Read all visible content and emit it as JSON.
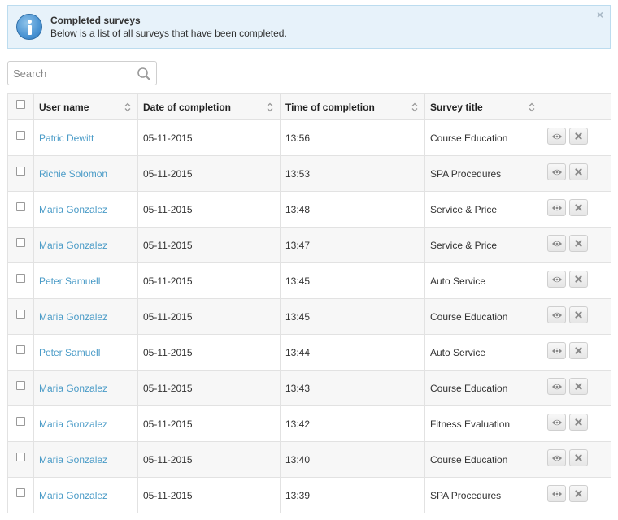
{
  "alert": {
    "title": "Completed surveys",
    "text": "Below is a list of all surveys that have been completed.",
    "close_glyph": "×",
    "icon": "info-icon",
    "accent_color": "#4b94d3"
  },
  "search": {
    "placeholder": "Search",
    "value": ""
  },
  "table": {
    "columns": {
      "user": "User name",
      "date": "Date of completion",
      "time": "Time of completion",
      "survey": "Survey title"
    },
    "link_color": "#4a9bc7",
    "rows": [
      {
        "user": "Patric Dewitt",
        "date": "05-11-2015",
        "time": "13:56",
        "survey": "Course Education"
      },
      {
        "user": "Richie Solomon",
        "date": "05-11-2015",
        "time": "13:53",
        "survey": "SPA Procedures"
      },
      {
        "user": "Maria Gonzalez",
        "date": "05-11-2015",
        "time": "13:48",
        "survey": "Service & Price"
      },
      {
        "user": "Maria Gonzalez",
        "date": "05-11-2015",
        "time": "13:47",
        "survey": "Service & Price"
      },
      {
        "user": "Peter Samuell",
        "date": "05-11-2015",
        "time": "13:45",
        "survey": "Auto Service"
      },
      {
        "user": "Maria Gonzalez",
        "date": "05-11-2015",
        "time": "13:45",
        "survey": "Course Education"
      },
      {
        "user": "Peter Samuell",
        "date": "05-11-2015",
        "time": "13:44",
        "survey": "Auto Service"
      },
      {
        "user": "Maria Gonzalez",
        "date": "05-11-2015",
        "time": "13:43",
        "survey": "Course Education"
      },
      {
        "user": "Maria Gonzalez",
        "date": "05-11-2015",
        "time": "13:42",
        "survey": "Fitness Evaluation"
      },
      {
        "user": "Maria Gonzalez",
        "date": "05-11-2015",
        "time": "13:40",
        "survey": "Course Education"
      },
      {
        "user": "Maria Gonzalez",
        "date": "05-11-2015",
        "time": "13:39",
        "survey": "SPA Procedures"
      }
    ]
  }
}
